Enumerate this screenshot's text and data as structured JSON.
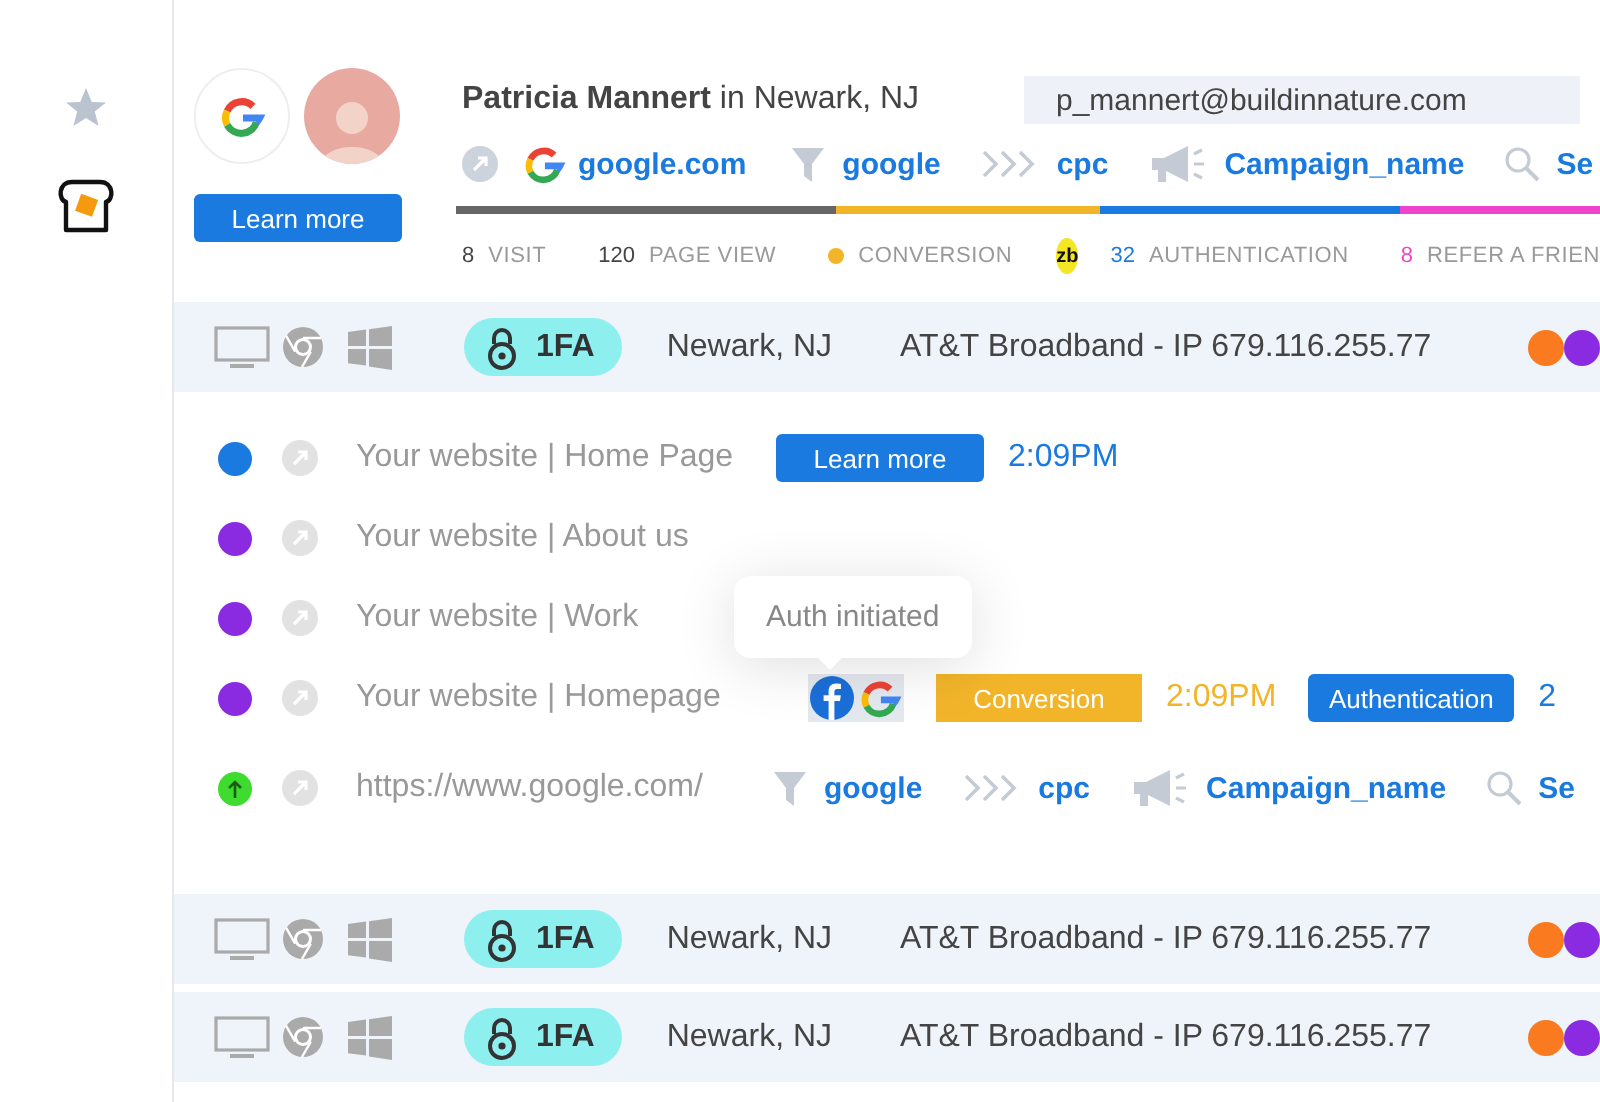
{
  "profile": {
    "name": "**Patricia Mannert** in Newark, NJ",
    "email": "p_mannert@buildinnature.com",
    "button": "Learn more"
  },
  "source": {
    "domain": "google.com",
    "utm": [
      {
        "kind": "source",
        "text": "google"
      },
      {
        "kind": "medium",
        "text": "cpc"
      },
      {
        "kind": "campaign",
        "text": "Campaign_name"
      },
      {
        "kind": "term",
        "text": "Se"
      }
    ]
  },
  "progress": [
    {
      "color": "#666666"
    },
    {
      "color": "#f2b52a"
    },
    {
      "color": "#1a7ae0"
    },
    {
      "color": "#ee44cc"
    }
  ],
  "stats": [
    {
      "kind": "count",
      "value": "8",
      "label": "VISIT",
      "color": "#444444"
    },
    {
      "kind": "count",
      "value": "120",
      "label": "PAGE VIEW",
      "color": "#444444"
    },
    {
      "kind": "dot",
      "color": "#f2b52a",
      "label": "CONVERSION"
    },
    {
      "kind": "logo",
      "text": "zb"
    },
    {
      "kind": "count",
      "value": "32",
      "label": "AUTHENTICATION",
      "color": "#1a7ae0"
    },
    {
      "kind": "count",
      "value": "8",
      "label": "REFER A FRIEN",
      "color": "#ee44cc"
    }
  ],
  "sessions": [
    {
      "auth": "1FA",
      "location": "Newark, NJ",
      "isp": "AT&T Broadband - IP 679.116.255.77",
      "events": [
        {
          "kind": "page",
          "color": "#1a7ae0",
          "page": "Your website | Home Page",
          "extras": [
            {
              "kind": "button",
              "text": "Learn more"
            },
            {
              "kind": "time",
              "text": "2:09PM",
              "color": "#1a7ae0"
            }
          ]
        },
        {
          "kind": "page",
          "color": "#8a2be2",
          "page": "Your website | About us"
        },
        {
          "kind": "page",
          "color": "#8a2be2",
          "page": "Your website | Work"
        },
        {
          "kind": "page",
          "color": "#8a2be2",
          "page": "Your website | Homepage",
          "extras": [
            {
              "kind": "social",
              "tooltip": "Auth initiated"
            },
            {
              "kind": "badge",
              "text": "Conversion",
              "color": "#f2b52a"
            },
            {
              "kind": "time",
              "text": "2:09PM",
              "color": "#f2b52a"
            },
            {
              "kind": "button",
              "text": "Authentication"
            },
            {
              "kind": "time",
              "text": "2",
              "color": "#1a7ae0"
            }
          ]
        },
        {
          "kind": "referrer",
          "color": "#3ddc2f",
          "page": "https://www.google.com/",
          "utm": [
            {
              "kind": "source",
              "text": "google"
            },
            {
              "kind": "medium",
              "text": "cpc"
            },
            {
              "kind": "campaign",
              "text": "Campaign_name"
            },
            {
              "kind": "term",
              "text": "Se"
            }
          ]
        }
      ]
    },
    {
      "auth": "1FA",
      "location": "Newark, NJ",
      "isp": "AT&T Broadband - IP 679.116.255.77"
    },
    {
      "auth": "1FA",
      "location": "Newark, NJ",
      "isp": "AT&T Broadband - IP 679.116.255.77"
    }
  ]
}
